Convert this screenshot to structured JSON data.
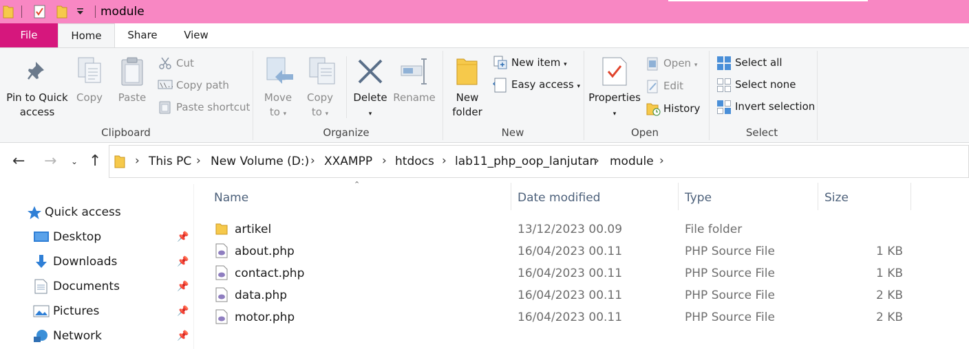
{
  "window": {
    "title": "module"
  },
  "ribbon_tabs": {
    "file": "File",
    "home": "Home",
    "share": "Share",
    "view": "View"
  },
  "clipboard": {
    "pin_line1": "Pin to Quick",
    "pin_line2": "access",
    "copy": "Copy",
    "paste": "Paste",
    "cut": "Cut",
    "copy_path": "Copy path",
    "paste_shortcut": "Paste shortcut",
    "group": "Clipboard"
  },
  "organize": {
    "move_line1": "Move",
    "move_line2": "to",
    "copy_line1": "Copy",
    "copy_line2": "to",
    "delete": "Delete",
    "rename": "Rename",
    "group": "Organize"
  },
  "new": {
    "folder_line1": "New",
    "folder_line2": "folder",
    "new_item": "New item",
    "easy_access": "Easy access",
    "group": "New"
  },
  "open": {
    "properties": "Properties",
    "open": "Open",
    "edit": "Edit",
    "history": "History",
    "group": "Open"
  },
  "select": {
    "select_all": "Select all",
    "select_none": "Select none",
    "invert": "Invert selection",
    "group": "Select"
  },
  "breadcrumb": [
    "This PC",
    "New Volume (D:)",
    "XXAMPP",
    "htdocs",
    "lab11_php_oop_lanjutan",
    "module"
  ],
  "nav": {
    "quick_access": "Quick access",
    "items": [
      "Desktop",
      "Downloads",
      "Documents",
      "Pictures",
      "Network"
    ]
  },
  "columns": {
    "name": "Name",
    "date": "Date modified",
    "type": "Type",
    "size": "Size"
  },
  "files": [
    {
      "name": "artikel",
      "date": "13/12/2023 00.09",
      "type": "File folder",
      "size": ""
    },
    {
      "name": "about.php",
      "date": "16/04/2023 00.11",
      "type": "PHP Source File",
      "size": "1 KB"
    },
    {
      "name": "contact.php",
      "date": "16/04/2023 00.11",
      "type": "PHP Source File",
      "size": "1 KB"
    },
    {
      "name": "data.php",
      "date": "16/04/2023 00.11",
      "type": "PHP Source File",
      "size": "2 KB"
    },
    {
      "name": "motor.php",
      "date": "16/04/2023 00.11",
      "type": "PHP Source File",
      "size": "2 KB"
    }
  ],
  "colors": {
    "title_bar": "#f887c3",
    "file_tab": "#d6177d",
    "ribbon_bg": "#f5f6f7",
    "folder": "#f6c94b"
  }
}
